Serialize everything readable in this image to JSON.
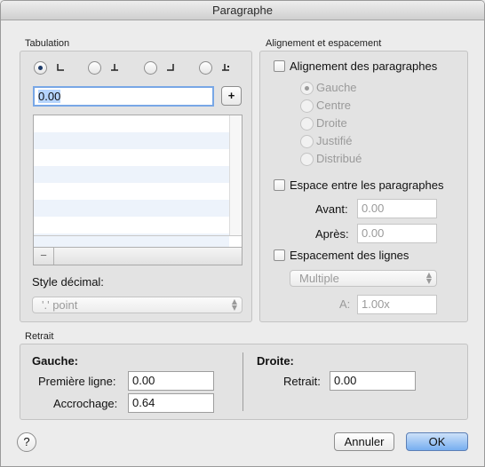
{
  "window": {
    "title": "Paragraphe"
  },
  "tabulation": {
    "section_label": "Tabulation",
    "tab_types": [
      {
        "id": "left",
        "selected": true
      },
      {
        "id": "center",
        "selected": false
      },
      {
        "id": "right",
        "selected": false
      },
      {
        "id": "decimal",
        "selected": false
      }
    ],
    "position_value": "0.00",
    "add_label": "+",
    "remove_label": "−",
    "decimal_style_label": "Style décimal:",
    "decimal_style_value": "'.' point"
  },
  "alignment": {
    "section_label": "Alignement et espacement",
    "paragraph_alignment": {
      "label": "Alignement des paragraphes",
      "checked": false,
      "options": [
        "Gauche",
        "Centre",
        "Droite",
        "Justifié",
        "Distribué"
      ],
      "selected": "Gauche"
    },
    "paragraph_spacing": {
      "label": "Espace entre les paragraphes",
      "checked": false,
      "before_label": "Avant:",
      "before_value": "0.00",
      "after_label": "Après:",
      "after_value": "0.00"
    },
    "line_spacing": {
      "label": "Espacement des lignes",
      "checked": false,
      "mode_value": "Multiple",
      "at_label": "A:",
      "at_value": "1.00x"
    }
  },
  "indent": {
    "section_label": "Retrait",
    "left_heading": "Gauche:",
    "first_line_label": "Première ligne:",
    "first_line_value": "0.00",
    "hanging_label": "Accrochage:",
    "hanging_value": "0.64",
    "right_heading": "Droite:",
    "right_label": "Retrait:",
    "right_value": "0.00"
  },
  "footer": {
    "help_label": "?",
    "cancel_label": "Annuler",
    "ok_label": "OK"
  }
}
